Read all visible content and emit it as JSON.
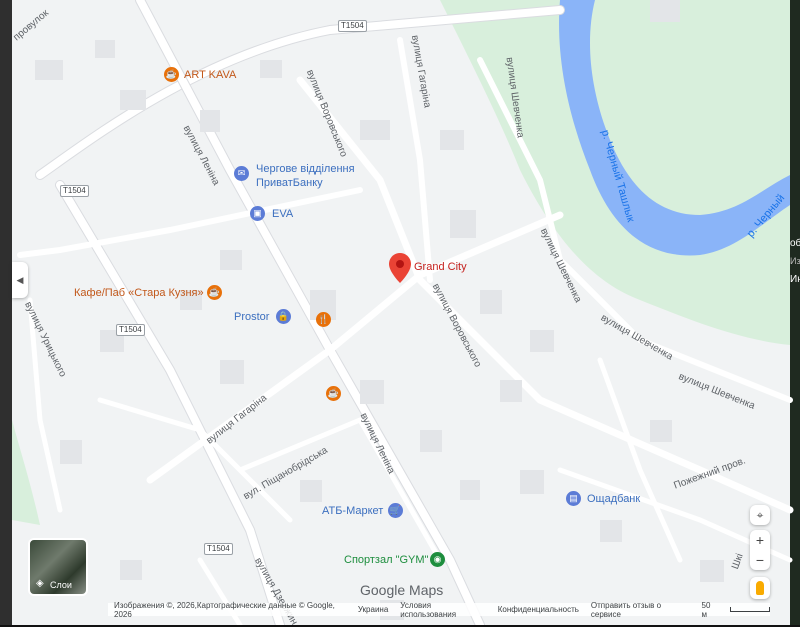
{
  "map": {
    "streets": {
      "provulok": "провулок",
      "vorovskogo_top": "вулиця Воровського",
      "gagarina_top": "вулиця Гагаріна",
      "shevchenka_top": "вулиця Шевченка",
      "lenina_top": "вулиця Леніна",
      "urytskogo": "вулиця Урицького",
      "shevchenka_mid": "вулиця Шевченка",
      "vorovskogo_mid": "вулиця Воровського",
      "shevchenka_right1": "вулиця Шевченка",
      "shevchenka_right2": "вулиця Шевченка",
      "gagarina_mid": "вулиця Гагаріна",
      "pishchanobridska": "вул. Піщанобрідська",
      "lenina_bottom": "вулиця Леніна",
      "pozhezhnyi": "Пожежний пров.",
      "dzerzhyn": "вулиця Дзержин",
      "shki": "Шкі"
    },
    "route_shields": [
      "T1504",
      "T1504",
      "T1504",
      "T1504"
    ],
    "rivers": {
      "chernyi_tashlyk": "р. Черный Ташлык",
      "chernyi": "р. Черный"
    },
    "pois": {
      "art_kava": "ART KAVA",
      "chergove": "Чергове відділення",
      "chergove2": "ПриватБанку",
      "eva": "EVA",
      "grand_city": "Grand City",
      "kafe": "Кафе/Паб «Стара Кузня»",
      "prostor": "Prostor",
      "atb": "АТБ-Маркет",
      "oshchadbank": "Ощадбанк",
      "sportzal": "Спортзал \"GYM\""
    },
    "edge_text": [
      "об",
      "Изо",
      "Ин"
    ]
  },
  "controls": {
    "layers_label": "Слои",
    "zoom_in": "+",
    "zoom_out": "−",
    "collapse": "◀"
  },
  "branding": {
    "google_maps": "Google Maps"
  },
  "footer": {
    "images": "Изображения ©, 2026,Картографические данные © Google, 2026",
    "country": "Украина",
    "terms": "Условия использования",
    "privacy": "Конфиденциальность",
    "feedback": "Отправить отзыв о сервисе",
    "scale": "50 м"
  },
  "colors": {
    "land": "#f1f3f4",
    "park": "#d4efdf",
    "water": "#8ab4f8",
    "road": "#ffffff",
    "pin": "#ea4335"
  }
}
